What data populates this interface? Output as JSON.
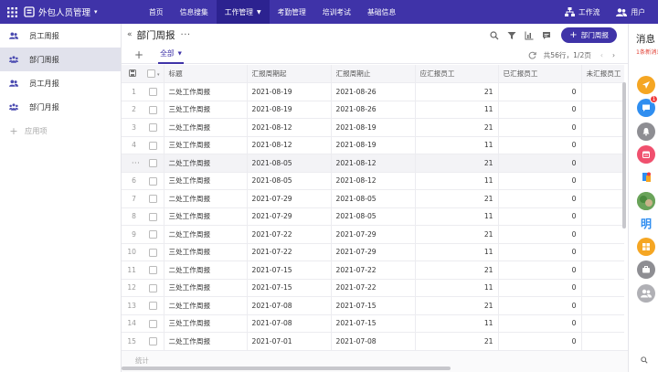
{
  "topbar": {
    "app_title": "外包人员管理",
    "nav": [
      {
        "label": "首页",
        "active": false
      },
      {
        "label": "信息搜集",
        "active": false
      },
      {
        "label": "工作管理",
        "active": true
      },
      {
        "label": "考勤管理",
        "active": false
      },
      {
        "label": "培训考试",
        "active": false
      },
      {
        "label": "基础信息",
        "active": false
      }
    ],
    "workflow_label": "工作流",
    "user_label": "用户"
  },
  "sidebar": {
    "items": [
      {
        "label": "员工周报",
        "icon": "users-icon",
        "active": false
      },
      {
        "label": "部门周报",
        "icon": "group-icon",
        "active": true
      },
      {
        "label": "员工月报",
        "icon": "users-icon",
        "active": false
      },
      {
        "label": "部门月报",
        "icon": "group-icon",
        "active": false
      }
    ],
    "add_label": "应用项"
  },
  "page": {
    "title": "部门周报",
    "more": "···",
    "add_button": "部门周报",
    "tab_label": "全部",
    "pager_text": "共56行，1/2页"
  },
  "table": {
    "columns": [
      "标题",
      "汇报周期起",
      "汇报周期止",
      "应汇报员工",
      "已汇报员工",
      "未汇报员工"
    ],
    "rows": [
      {
        "n": "1",
        "title": "二处工作周报",
        "start": "2021-08-19",
        "end": "2021-08-26",
        "due": "21",
        "done": "0",
        "hover": false
      },
      {
        "n": "2",
        "title": "三处工作周报",
        "start": "2021-08-19",
        "end": "2021-08-26",
        "due": "11",
        "done": "0",
        "hover": false
      },
      {
        "n": "3",
        "title": "二处工作周报",
        "start": "2021-08-12",
        "end": "2021-08-19",
        "due": "21",
        "done": "0",
        "hover": false
      },
      {
        "n": "4",
        "title": "三处工作周报",
        "start": "2021-08-12",
        "end": "2021-08-19",
        "due": "11",
        "done": "0",
        "hover": false
      },
      {
        "n": "",
        "title": "二处工作周报",
        "start": "2021-08-05",
        "end": "2021-08-12",
        "due": "21",
        "done": "0",
        "hover": true
      },
      {
        "n": "6",
        "title": "三处工作周报",
        "start": "2021-08-05",
        "end": "2021-08-12",
        "due": "11",
        "done": "0",
        "hover": false
      },
      {
        "n": "7",
        "title": "二处工作周报",
        "start": "2021-07-29",
        "end": "2021-08-05",
        "due": "21",
        "done": "0",
        "hover": false
      },
      {
        "n": "8",
        "title": "三处工作周报",
        "start": "2021-07-29",
        "end": "2021-08-05",
        "due": "11",
        "done": "0",
        "hover": false
      },
      {
        "n": "9",
        "title": "二处工作周报",
        "start": "2021-07-22",
        "end": "2021-07-29",
        "due": "21",
        "done": "0",
        "hover": false
      },
      {
        "n": "10",
        "title": "三处工作周报",
        "start": "2021-07-22",
        "end": "2021-07-29",
        "due": "11",
        "done": "0",
        "hover": false
      },
      {
        "n": "11",
        "title": "二处工作周报",
        "start": "2021-07-15",
        "end": "2021-07-22",
        "due": "21",
        "done": "0",
        "hover": false
      },
      {
        "n": "12",
        "title": "三处工作周报",
        "start": "2021-07-15",
        "end": "2021-07-22",
        "due": "11",
        "done": "0",
        "hover": false
      },
      {
        "n": "13",
        "title": "二处工作周报",
        "start": "2021-07-08",
        "end": "2021-07-15",
        "due": "21",
        "done": "0",
        "hover": false
      },
      {
        "n": "14",
        "title": "三处工作周报",
        "start": "2021-07-08",
        "end": "2021-07-15",
        "due": "11",
        "done": "0",
        "hover": false
      },
      {
        "n": "15",
        "title": "二处工作周报",
        "start": "2021-07-01",
        "end": "2021-07-08",
        "due": "21",
        "done": "0",
        "hover": false
      }
    ],
    "footer_label": "统计"
  },
  "messages": {
    "title": "消息",
    "new_text": "1条新消息",
    "icons": [
      {
        "name": "send-icon",
        "color": "#f5a623",
        "badge": ""
      },
      {
        "name": "chat-icon",
        "color": "#2f8ef0",
        "badge": "1"
      },
      {
        "name": "bell-icon",
        "color": "#8e8e93",
        "badge": ""
      },
      {
        "name": "calendar-icon",
        "color": "#f0506e",
        "badge": ""
      },
      {
        "name": "app-icon",
        "color": "#2f8ef0",
        "badge": ""
      },
      {
        "name": "photo-avatar-icon",
        "color": "#5aa64a",
        "badge": ""
      },
      {
        "name": "ming-app-icon",
        "color": "#ffffff",
        "badge": ""
      },
      {
        "name": "apps-grid-icon",
        "color": "#f5a623",
        "badge": ""
      },
      {
        "name": "briefcase-icon",
        "color": "#8e8e93",
        "badge": ""
      },
      {
        "name": "people-icon",
        "color": "#b0b0b5",
        "badge": ""
      }
    ],
    "ming_char": "明"
  },
  "colors": {
    "brand": "#3f33a8",
    "brand_dark": "#2c2290",
    "active_side": "#e1e2ec"
  }
}
